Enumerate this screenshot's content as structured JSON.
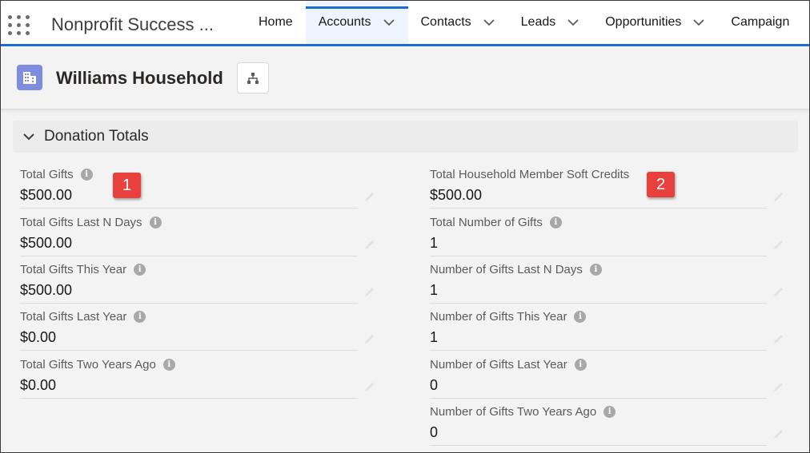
{
  "nav": {
    "app_name": "Nonprofit Success ...",
    "items": [
      {
        "label": "Home",
        "has_menu": false,
        "active": false
      },
      {
        "label": "Accounts",
        "has_menu": true,
        "active": true
      },
      {
        "label": "Contacts",
        "has_menu": true,
        "active": false
      },
      {
        "label": "Leads",
        "has_menu": true,
        "active": false
      },
      {
        "label": "Opportunities",
        "has_menu": true,
        "active": false
      },
      {
        "label": "Campaign",
        "has_menu": false,
        "active": false
      }
    ],
    "accent_color": "#1b6ed0"
  },
  "record": {
    "title": "Williams Household",
    "icon": "household-account-icon",
    "icon_color": "#7f8de1",
    "hierarchy_icon": "hierarchy-icon"
  },
  "section": {
    "title": "Donation Totals",
    "expanded": true
  },
  "fields": {
    "left": [
      {
        "label": "Total Gifts",
        "value": "$500.00"
      },
      {
        "label": "Total Gifts Last N Days",
        "value": "$500.00"
      },
      {
        "label": "Total Gifts This Year",
        "value": "$500.00"
      },
      {
        "label": "Total Gifts Last Year",
        "value": "$0.00"
      },
      {
        "label": "Total Gifts Two Years Ago",
        "value": "$0.00"
      }
    ],
    "right": [
      {
        "label": "Total Household Member Soft Credits",
        "value": "$500.00"
      },
      {
        "label": "Total Number of Gifts",
        "value": "1"
      },
      {
        "label": "Number of Gifts Last N Days",
        "value": "1"
      },
      {
        "label": "Number of Gifts This Year",
        "value": "1"
      },
      {
        "label": "Number of Gifts Last Year",
        "value": "0"
      },
      {
        "label": "Number of Gifts Two Years Ago",
        "value": "0"
      }
    ]
  },
  "callouts": {
    "first": "1",
    "second": "2",
    "color": "#e8403d"
  }
}
